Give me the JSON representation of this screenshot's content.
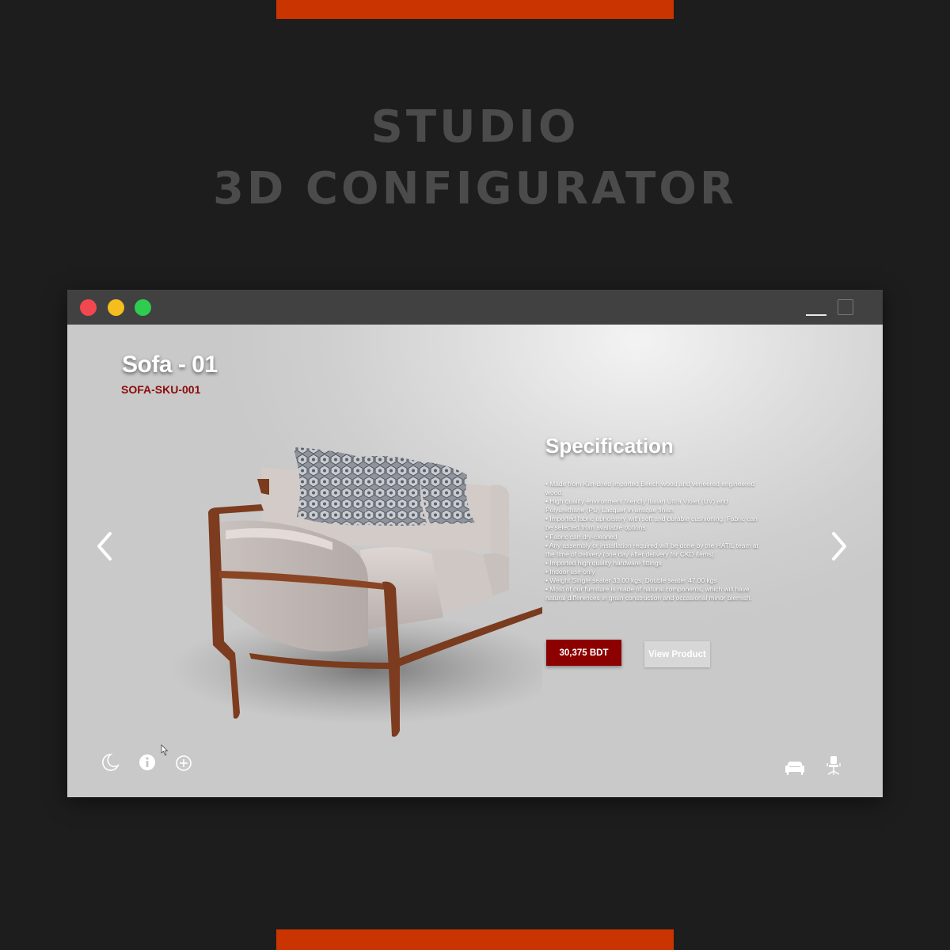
{
  "page": {
    "headline_line1": "STUDIO",
    "headline_line2": "3D CONFIGURATOR",
    "accent_color": "#c93400"
  },
  "window": {
    "controls": [
      "close",
      "minimize",
      "zoom"
    ],
    "control_colors": [
      "#f2474e",
      "#f5bd1d",
      "#2ecc4f"
    ]
  },
  "product": {
    "name": "Sofa - 01",
    "sku": "SOFA-SKU-001",
    "spec_heading": "Specification",
    "specs": [
      "Made from Kiln-dried imported Beech wood and veneered engineered wood.",
      "High quality environment friendly Italian Ultra Violet (UV) and Polyurethane (PU) Lacquer in antique finish",
      "Imported fabric upholstery with soft and durable cushioning. Fabric can be selected from available options",
      "Fabric can dry-cleaned",
      "Any assembly or installation required will be done by the HATIL team at the time of delivery (one day after delivery for CKD items)",
      "Imported high quality hardware fittings",
      "Indoor use only",
      "Weight Single seater 33.00 kgs, Double seater 47.00 kgs",
      "Most of our furniture is made of natural components, which will have natural differences in grain construction and occasional minor blemish."
    ],
    "price_label": "30,375 BDT",
    "view_label": "View Product",
    "price_color": "#8c0000"
  },
  "toolbar": {
    "left_icons": [
      "moon-icon",
      "info-icon",
      "plus-circle-icon"
    ],
    "right_icons": [
      "sofa-icon",
      "office-chair-icon"
    ]
  }
}
